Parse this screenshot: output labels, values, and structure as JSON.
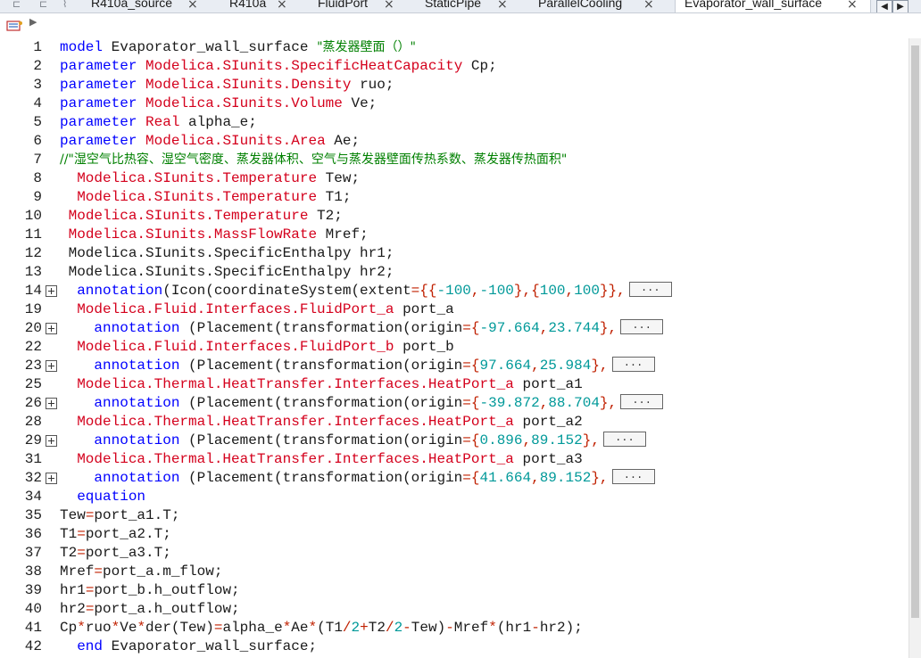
{
  "tabs": [
    {
      "label": "R410a_source",
      "close": "×"
    },
    {
      "label": "R410a",
      "close": "×"
    },
    {
      "label": "FluidPort",
      "close": "×"
    },
    {
      "label": "StaticPipe",
      "close": "×"
    },
    {
      "label": "ParallelCooling",
      "close": "×"
    },
    {
      "label": "Evaporator_wall_surface",
      "close": "×",
      "active": true
    }
  ],
  "tabbar_icons": [
    "window-icon",
    "window-icon",
    "divider-icon"
  ],
  "nav_buttons": {
    "prev": "◀",
    "next": "▶"
  },
  "toolbar": {
    "model_icon": "modelica-class-icon",
    "expand": "▶"
  },
  "colors": {
    "keyword": "#0000ff",
    "type": "#d4001c",
    "comment": "#008000",
    "string": "#008000",
    "number": "#009999",
    "operator": "#c02000",
    "text": "#1a1a1a"
  },
  "code": [
    {
      "n": "1",
      "tokens": [
        [
          "k",
          "model"
        ],
        [
          "t",
          " Evaporator_wall_surface "
        ],
        [
          "s",
          "\"蒸发器壁面（）\""
        ]
      ]
    },
    {
      "n": "2",
      "tokens": [
        [
          "k",
          "parameter"
        ],
        [
          "t",
          " "
        ],
        [
          "r",
          "Modelica.SIunits.SpecificHeatCapacity"
        ],
        [
          "t",
          " Cp;"
        ]
      ]
    },
    {
      "n": "3",
      "tokens": [
        [
          "k",
          "parameter"
        ],
        [
          "t",
          " "
        ],
        [
          "r",
          "Modelica.SIunits.Density"
        ],
        [
          "t",
          " ruo;"
        ]
      ]
    },
    {
      "n": "4",
      "tokens": [
        [
          "k",
          "parameter"
        ],
        [
          "t",
          " "
        ],
        [
          "r",
          "Modelica.SIunits.Volume"
        ],
        [
          "t",
          " Ve;"
        ]
      ]
    },
    {
      "n": "5",
      "tokens": [
        [
          "k",
          "parameter"
        ],
        [
          "t",
          " "
        ],
        [
          "r",
          "Real"
        ],
        [
          "t",
          " alpha_e;"
        ]
      ]
    },
    {
      "n": "6",
      "tokens": [
        [
          "k",
          "parameter"
        ],
        [
          "t",
          " "
        ],
        [
          "r",
          "Modelica.SIunits.Area"
        ],
        [
          "t",
          " Ae;"
        ]
      ]
    },
    {
      "n": "7",
      "tokens": [
        [
          "c",
          "//\"湿空气比热容、湿空气密度、蒸发器体积、空气与蒸发器壁面传热系数、蒸发器传热面积\""
        ]
      ]
    },
    {
      "n": "8",
      "tokens": [
        [
          "t",
          "  "
        ],
        [
          "r",
          "Modelica.SIunits.Temperature"
        ],
        [
          "t",
          " Tew;"
        ]
      ]
    },
    {
      "n": "9",
      "tokens": [
        [
          "t",
          "  "
        ],
        [
          "r",
          "Modelica.SIunits.Temperature"
        ],
        [
          "t",
          " T1;"
        ]
      ]
    },
    {
      "n": "10",
      "tokens": [
        [
          "t",
          " "
        ],
        [
          "r",
          "Modelica.SIunits.Temperature"
        ],
        [
          "t",
          " T2;"
        ]
      ]
    },
    {
      "n": "11",
      "tokens": [
        [
          "t",
          " "
        ],
        [
          "r",
          "Modelica.SIunits.MassFlowRate"
        ],
        [
          "t",
          " Mref;"
        ]
      ]
    },
    {
      "n": "12",
      "tokens": [
        [
          "t",
          " Modelica.SIunits.SpecificEnthalpy hr1;"
        ]
      ]
    },
    {
      "n": "13",
      "tokens": [
        [
          "t",
          " Modelica.SIunits.SpecificEnthalpy hr2;"
        ]
      ]
    },
    {
      "n": "14",
      "fold": true,
      "tokens": [
        [
          "t",
          "  "
        ],
        [
          "k",
          "annotation"
        ],
        [
          "t",
          "(Icon(coordinateSystem(extent"
        ],
        [
          "o",
          "={{"
        ],
        [
          "n",
          "-100"
        ],
        [
          "o",
          ","
        ],
        [
          "n",
          "-100"
        ],
        [
          "o",
          "},{"
        ],
        [
          "n",
          "100"
        ],
        [
          "o",
          ","
        ],
        [
          "n",
          "100"
        ],
        [
          "o",
          "}},"
        ],
        [
          "e",
          "..."
        ]
      ]
    },
    {
      "n": "19",
      "tokens": [
        [
          "t",
          "  "
        ],
        [
          "r",
          "Modelica.Fluid.Interfaces.FluidPort_a"
        ],
        [
          "t",
          " port_a"
        ]
      ]
    },
    {
      "n": "20",
      "fold": true,
      "tokens": [
        [
          "t",
          "    "
        ],
        [
          "k",
          "annotation"
        ],
        [
          "t",
          " (Placement(transformation(origin"
        ],
        [
          "o",
          "={"
        ],
        [
          "n",
          "-97.664"
        ],
        [
          "o",
          ","
        ],
        [
          "n",
          "23.744"
        ],
        [
          "o",
          "},"
        ],
        [
          "e",
          "..."
        ]
      ]
    },
    {
      "n": "22",
      "tokens": [
        [
          "t",
          "  "
        ],
        [
          "r",
          "Modelica.Fluid.Interfaces.FluidPort_b"
        ],
        [
          "t",
          " port_b"
        ]
      ]
    },
    {
      "n": "23",
      "fold": true,
      "tokens": [
        [
          "t",
          "    "
        ],
        [
          "k",
          "annotation"
        ],
        [
          "t",
          " (Placement(transformation(origin"
        ],
        [
          "o",
          "={"
        ],
        [
          "n",
          "97.664"
        ],
        [
          "o",
          ","
        ],
        [
          "n",
          "25.984"
        ],
        [
          "o",
          "},"
        ],
        [
          "e",
          "..."
        ]
      ]
    },
    {
      "n": "25",
      "tokens": [
        [
          "t",
          "  "
        ],
        [
          "r",
          "Modelica.Thermal.HeatTransfer.Interfaces.HeatPort_a"
        ],
        [
          "t",
          " port_a1"
        ]
      ]
    },
    {
      "n": "26",
      "fold": true,
      "tokens": [
        [
          "t",
          "    "
        ],
        [
          "k",
          "annotation"
        ],
        [
          "t",
          " (Placement(transformation(origin"
        ],
        [
          "o",
          "={"
        ],
        [
          "n",
          "-39.872"
        ],
        [
          "o",
          ","
        ],
        [
          "n",
          "88.704"
        ],
        [
          "o",
          "},"
        ],
        [
          "e",
          "..."
        ]
      ]
    },
    {
      "n": "28",
      "tokens": [
        [
          "t",
          "  "
        ],
        [
          "r",
          "Modelica.Thermal.HeatTransfer.Interfaces.HeatPort_a"
        ],
        [
          "t",
          " port_a2"
        ]
      ]
    },
    {
      "n": "29",
      "fold": true,
      "tokens": [
        [
          "t",
          "    "
        ],
        [
          "k",
          "annotation"
        ],
        [
          "t",
          " (Placement(transformation(origin"
        ],
        [
          "o",
          "={"
        ],
        [
          "n",
          "0.896"
        ],
        [
          "o",
          ","
        ],
        [
          "n",
          "89.152"
        ],
        [
          "o",
          "},"
        ],
        [
          "e",
          "..."
        ]
      ]
    },
    {
      "n": "31",
      "tokens": [
        [
          "t",
          "  "
        ],
        [
          "r",
          "Modelica.Thermal.HeatTransfer.Interfaces.HeatPort_a"
        ],
        [
          "t",
          " port_a3"
        ]
      ]
    },
    {
      "n": "32",
      "fold": true,
      "tokens": [
        [
          "t",
          "    "
        ],
        [
          "k",
          "annotation"
        ],
        [
          "t",
          " (Placement(transformation(origin"
        ],
        [
          "o",
          "={"
        ],
        [
          "n",
          "41.664"
        ],
        [
          "o",
          ","
        ],
        [
          "n",
          "89.152"
        ],
        [
          "o",
          "},"
        ],
        [
          "e",
          "..."
        ]
      ]
    },
    {
      "n": "34",
      "tokens": [
        [
          "t",
          "  "
        ],
        [
          "k",
          "equation"
        ]
      ]
    },
    {
      "n": "35",
      "tokens": [
        [
          "t",
          "Tew"
        ],
        [
          "o",
          "="
        ],
        [
          "t",
          "port_a1.T;"
        ]
      ]
    },
    {
      "n": "36",
      "tokens": [
        [
          "t",
          "T1"
        ],
        [
          "o",
          "="
        ],
        [
          "t",
          "port_a2.T;"
        ]
      ]
    },
    {
      "n": "37",
      "tokens": [
        [
          "t",
          "T2"
        ],
        [
          "o",
          "="
        ],
        [
          "t",
          "port_a3.T;"
        ]
      ]
    },
    {
      "n": "38",
      "tokens": [
        [
          "t",
          "Mref"
        ],
        [
          "o",
          "="
        ],
        [
          "t",
          "port_a.m_flow;"
        ]
      ]
    },
    {
      "n": "39",
      "tokens": [
        [
          "t",
          "hr1"
        ],
        [
          "o",
          "="
        ],
        [
          "t",
          "port_b.h_outflow;"
        ]
      ]
    },
    {
      "n": "40",
      "tokens": [
        [
          "t",
          "hr2"
        ],
        [
          "o",
          "="
        ],
        [
          "t",
          "port_a.h_outflow;"
        ]
      ]
    },
    {
      "n": "41",
      "tokens": [
        [
          "t",
          "Cp"
        ],
        [
          "o",
          "*"
        ],
        [
          "t",
          "ruo"
        ],
        [
          "o",
          "*"
        ],
        [
          "t",
          "Ve"
        ],
        [
          "o",
          "*"
        ],
        [
          "t",
          "der(Tew)"
        ],
        [
          "o",
          "="
        ],
        [
          "t",
          "alpha_e"
        ],
        [
          "o",
          "*"
        ],
        [
          "t",
          "Ae"
        ],
        [
          "o",
          "*"
        ],
        [
          "t",
          "(T1"
        ],
        [
          "o",
          "/"
        ],
        [
          "n",
          "2"
        ],
        [
          "o",
          "+"
        ],
        [
          "t",
          "T2"
        ],
        [
          "o",
          "/"
        ],
        [
          "n",
          "2"
        ],
        [
          "o",
          "-"
        ],
        [
          "t",
          "Tew)"
        ],
        [
          "o",
          "-"
        ],
        [
          "t",
          "Mref"
        ],
        [
          "o",
          "*"
        ],
        [
          "t",
          "(hr1"
        ],
        [
          "o",
          "-"
        ],
        [
          "t",
          "hr2);"
        ]
      ]
    },
    {
      "n": "42",
      "tokens": [
        [
          "t",
          "  "
        ],
        [
          "k",
          "end"
        ],
        [
          "t",
          " Evaporator_wall_surface;"
        ]
      ]
    }
  ]
}
